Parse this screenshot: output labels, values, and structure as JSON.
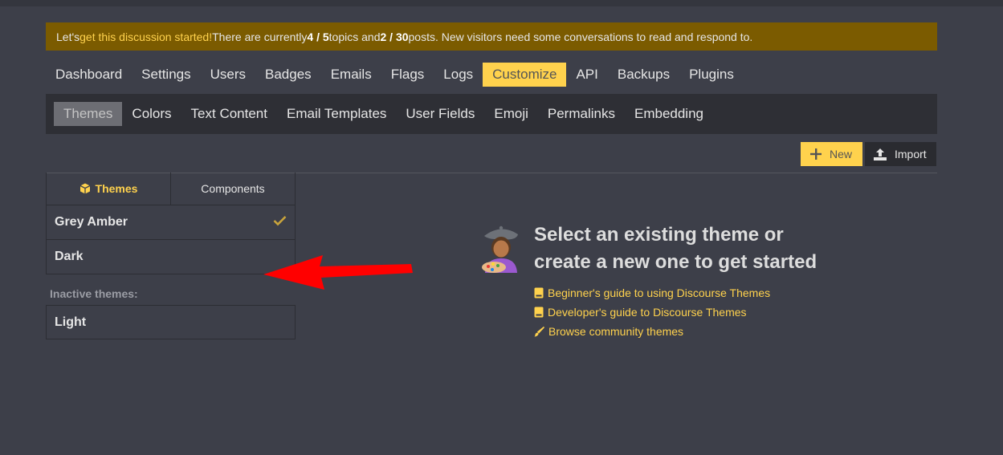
{
  "banner": {
    "pre": "Let's ",
    "link": "get this discussion started!",
    "mid1": " There are currently ",
    "topics_count": "4 / 5",
    "mid2": " topics and ",
    "posts_count": "2 / 30",
    "post": " posts. New visitors need some conversations to read and respond to."
  },
  "main_nav": {
    "items": [
      "Dashboard",
      "Settings",
      "Users",
      "Badges",
      "Emails",
      "Flags",
      "Logs",
      "Customize",
      "API",
      "Backups",
      "Plugins"
    ],
    "active": "Customize"
  },
  "sub_nav": {
    "items": [
      "Themes",
      "Colors",
      "Text Content",
      "Email Templates",
      "User Fields",
      "Emoji",
      "Permalinks",
      "Embedding"
    ],
    "active": "Themes"
  },
  "toolbar": {
    "new_label": "New",
    "import_label": "Import"
  },
  "tabs": {
    "themes": "Themes",
    "components": "Components"
  },
  "themes": {
    "active": [
      {
        "name": "Grey Amber",
        "default": true
      },
      {
        "name": "Dark",
        "default": false
      }
    ],
    "inactive_label": "Inactive themes:",
    "inactive": [
      {
        "name": "Light"
      }
    ]
  },
  "welcome": {
    "title_line1": "Select an existing theme or",
    "title_line2": "create a new one to get started",
    "links": [
      {
        "label": "Beginner's guide to using Discourse Themes",
        "icon": "book-icon"
      },
      {
        "label": "Developer's guide to Discourse Themes",
        "icon": "book-icon"
      },
      {
        "label": "Browse community themes",
        "icon": "paintbrush-icon"
      }
    ]
  },
  "colors": {
    "background": "#3d3f49",
    "accent": "#ffd24d",
    "banner": "#7b5b00",
    "subnav": "#2e2f35",
    "annotation_arrow": "#ff0000"
  }
}
